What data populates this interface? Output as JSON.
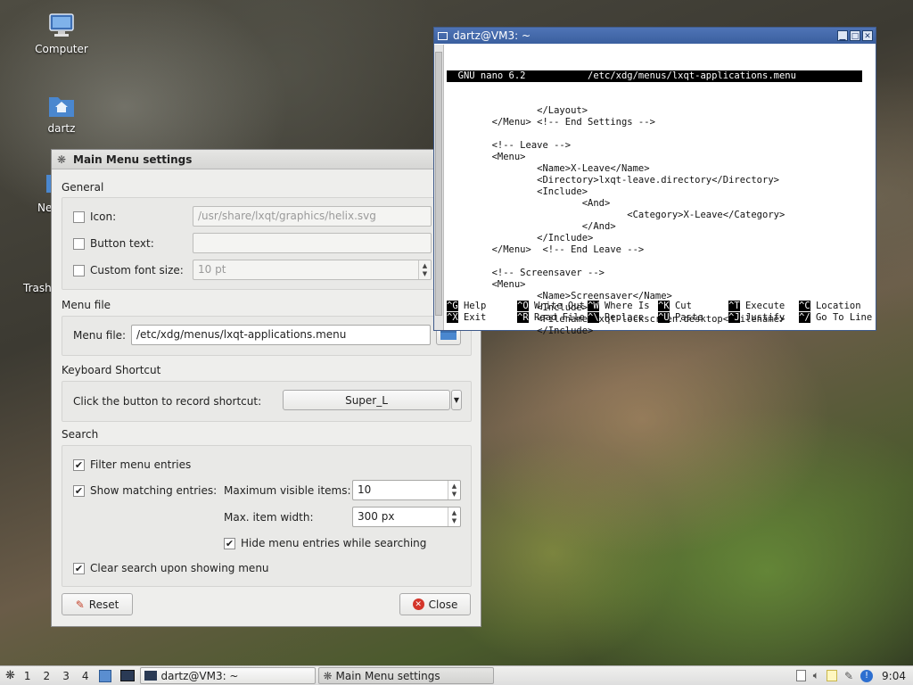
{
  "desktop": {
    "icons": [
      {
        "label": "Computer",
        "icon": "computer-icon"
      },
      {
        "label": "dartz",
        "icon": "home-folder-icon"
      },
      {
        "label": "Ne",
        "icon": "network-icon"
      },
      {
        "label": "Trash",
        "icon": "trash-icon"
      }
    ]
  },
  "dialog": {
    "title": "Main Menu settings",
    "general": {
      "heading": "General",
      "icon_label": "Icon:",
      "icon_value": "/usr/share/lxqt/graphics/helix.svg",
      "button_text_label": "Button text:",
      "button_text_value": "",
      "font_size_label": "Custom font size:",
      "font_size_value": "10 pt",
      "icon_checked": false,
      "button_text_checked": false,
      "font_size_checked": false
    },
    "menu_file": {
      "heading": "Menu file",
      "label": "Menu file:",
      "value": "/etc/xdg/menus/lxqt-applications.menu"
    },
    "shortcut": {
      "heading": "Keyboard Shortcut",
      "label": "Click the button to record shortcut:",
      "value": "Super_L"
    },
    "search": {
      "heading": "Search",
      "filter_label": "Filter menu entries",
      "filter_checked": true,
      "show_matching_label": "Show matching entries:",
      "show_matching_checked": true,
      "max_visible_label": "Maximum visible items:",
      "max_visible_value": "10",
      "max_width_label": "Max. item width:",
      "max_width_value": "300 px",
      "hide_label": "Hide menu entries while searching",
      "hide_checked": true,
      "clear_label": "Clear search upon showing menu",
      "clear_checked": true
    },
    "buttons": {
      "reset": "Reset",
      "close": "Close"
    }
  },
  "terminal": {
    "title": "dartz@VM3: ~",
    "header": "  GNU nano 6.2           /etc/xdg/menus/lxqt-applications.menu",
    "lines": [
      "                </Layout>",
      "        </Menu> <!-- End Settings -->",
      "",
      "        <!-- Leave -->",
      "        <Menu>",
      "                <Name>X-Leave</Name>",
      "                <Directory>lxqt-leave.directory</Directory>",
      "                <Include>",
      "                        <And>",
      "                                <Category>X-Leave</Category>",
      "                        </And>",
      "                </Include>",
      "        </Menu>  <!-- End Leave -->",
      "",
      "        <!-- Screensaver -->",
      "        <Menu>",
      "                <Name>Screensaver</Name>",
      "                <Include>",
      "                <Filename>lxqt-lockscreen.desktop</Filename>",
      "                </Include>"
    ],
    "help": [
      [
        {
          "key": "^G",
          "label": "Help"
        },
        {
          "key": "^O",
          "label": "Write Out"
        },
        {
          "key": "^W",
          "label": "Where Is"
        },
        {
          "key": "^K",
          "label": "Cut"
        },
        {
          "key": "^T",
          "label": "Execute"
        },
        {
          "key": "^C",
          "label": "Location"
        }
      ],
      [
        {
          "key": "^X",
          "label": "Exit"
        },
        {
          "key": "^R",
          "label": "Read File"
        },
        {
          "key": "^\\",
          "label": "Replace"
        },
        {
          "key": "^U",
          "label": "Paste"
        },
        {
          "key": "^J",
          "label": "Justify"
        },
        {
          "key": "^/",
          "label": "Go To Line"
        }
      ]
    ]
  },
  "taskbar": {
    "desktops": [
      "1",
      "2",
      "3",
      "4"
    ],
    "tasks": [
      {
        "label": "dartz@VM3: ~",
        "active": false
      },
      {
        "label": "Main Menu settings",
        "active": true
      }
    ],
    "clock": "9:04"
  }
}
